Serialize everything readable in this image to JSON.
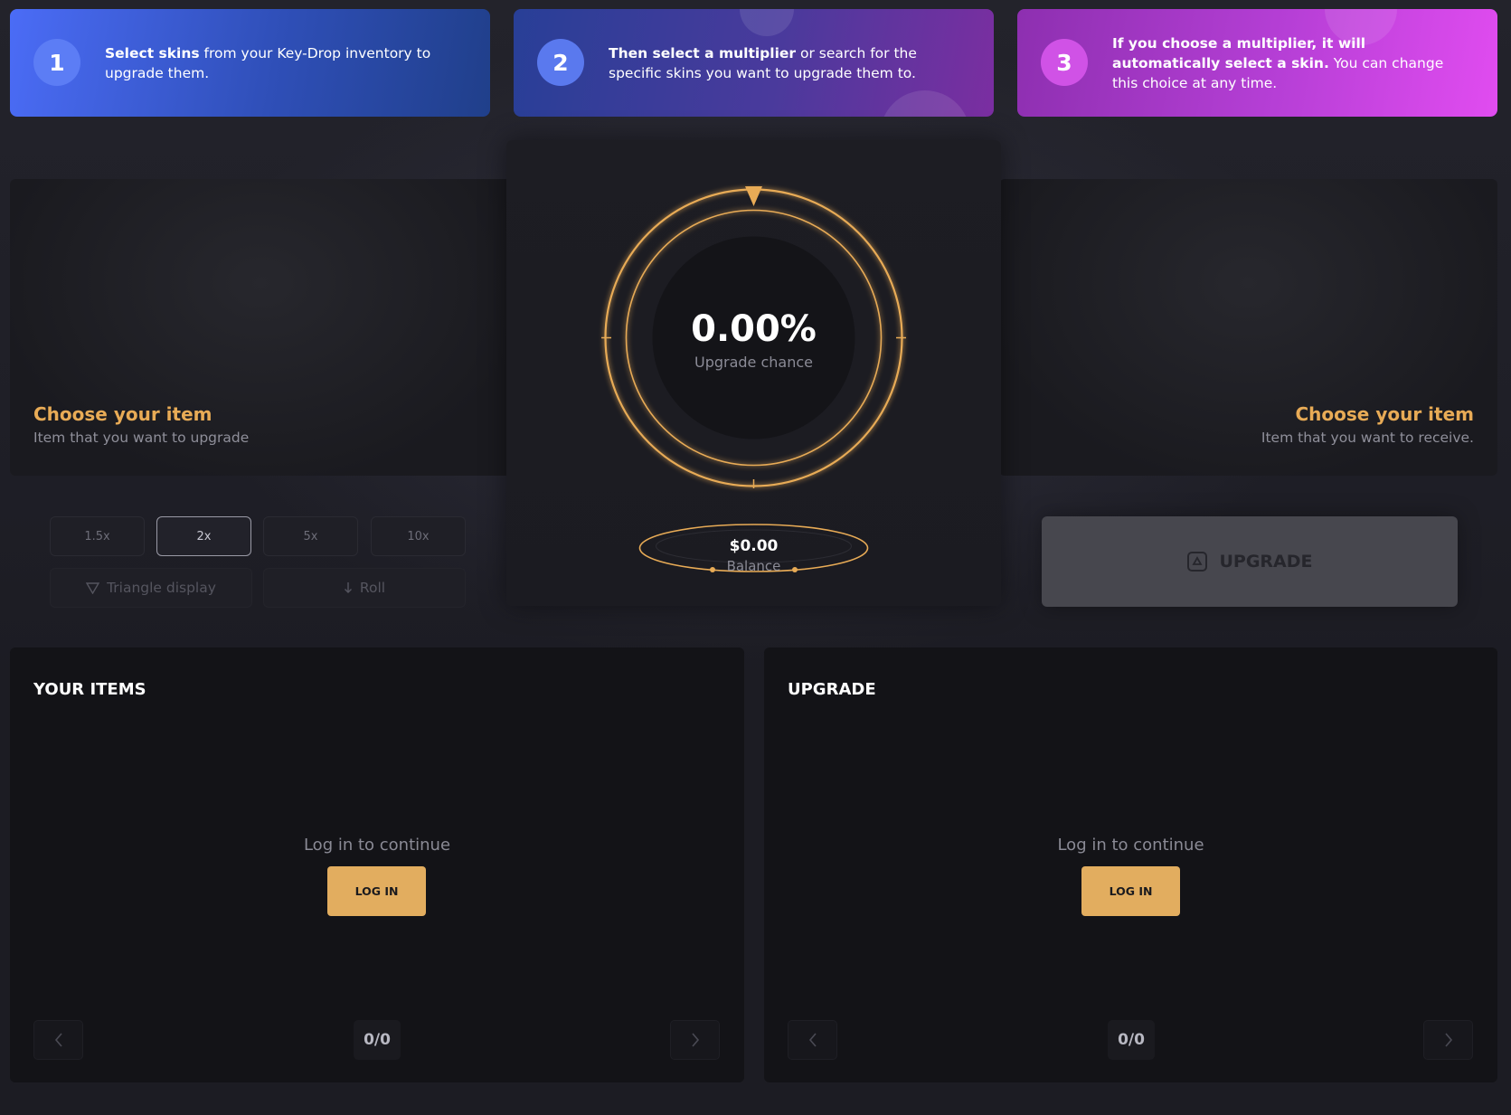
{
  "steps": [
    {
      "number": "1",
      "bold": "Select skins",
      "text": " from your Key-Drop inventory to upgrade them.",
      "bold2": "",
      "text2": ""
    },
    {
      "number": "2",
      "bold": "Then select a multiplier",
      "text": " or search for the specific skins you want to upgrade them to.",
      "bold2": "",
      "text2": ""
    },
    {
      "number": "3",
      "bold": "If you choose a multiplier, it will automatically select a skin.",
      "text": " You can change this choice at any time.",
      "bold2": "",
      "text2": ""
    }
  ],
  "source_item": {
    "title": "Choose your item",
    "subtitle": "Item that you want to upgrade"
  },
  "target_item": {
    "title": "Choose your item",
    "subtitle": "Item that you want to receive."
  },
  "chance": {
    "value": "0.00%",
    "label": "Upgrade chance",
    "fraction": 0.0
  },
  "balance": {
    "value": "$0.00",
    "label": "Balance"
  },
  "multipliers": [
    {
      "label": "1.5x",
      "active": false
    },
    {
      "label": "2x",
      "active": true
    },
    {
      "label": "5x",
      "active": false
    },
    {
      "label": "10x",
      "active": false
    }
  ],
  "tools": {
    "triangle_label": "Triangle display",
    "roll_label": "Roll"
  },
  "upgrade_button": {
    "label": "UPGRADE"
  },
  "your_items": {
    "title": "YOUR ITEMS",
    "login_text": "Log in to continue",
    "login_button": "LOG IN",
    "count": "0/0"
  },
  "upgrade_panel": {
    "title": "UPGRADE",
    "login_text": "Log in to continue",
    "login_button": "LOG IN",
    "count": "0/0"
  },
  "colors": {
    "accent": "#e2ad5f",
    "ring": "#e8ab56",
    "background": "#1c1c23",
    "panel": "#131317"
  },
  "icons": [
    "triangle-icon",
    "arrow-down-icon",
    "upgrade-icon",
    "chevron-left-icon",
    "chevron-right-icon",
    "pointer-arrow-icon"
  ]
}
